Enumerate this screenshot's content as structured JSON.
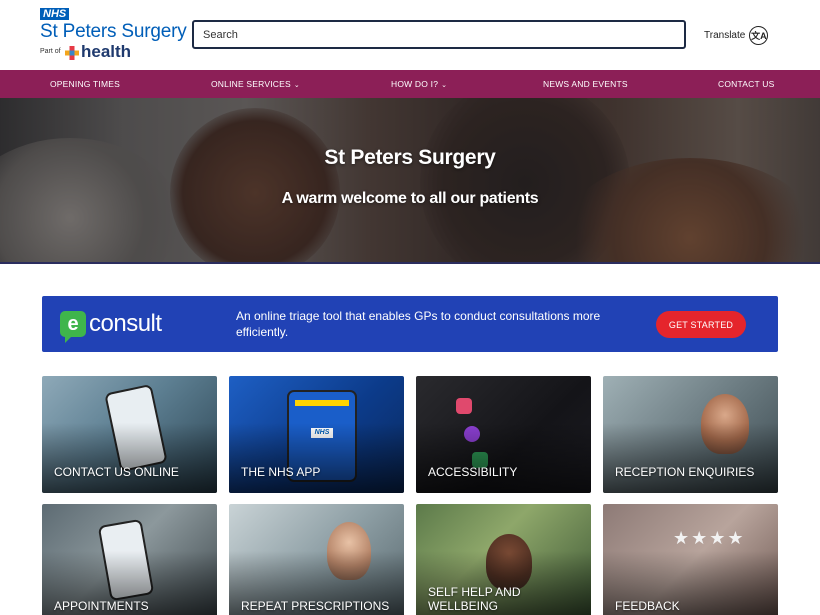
{
  "header": {
    "nhs_badge": "NHS",
    "practice_name": "St Peters Surgery",
    "part_of": "Part of",
    "health_word": "health",
    "search_placeholder": "Search",
    "translate_label": "Translate",
    "translate_icon": "translate-icon"
  },
  "nav": {
    "items": [
      {
        "label": "OPENING TIMES",
        "has_dropdown": false
      },
      {
        "label": "ONLINE SERVICES",
        "has_dropdown": true
      },
      {
        "label": "HOW DO I?",
        "has_dropdown": true
      },
      {
        "label": "NEWS AND EVENTS",
        "has_dropdown": false
      },
      {
        "label": "CONTACT US",
        "has_dropdown": false
      }
    ],
    "dropdown_glyph": "⌄"
  },
  "hero": {
    "title": "St Peters Surgery",
    "subtitle": "A warm welcome to all our patients"
  },
  "econsult": {
    "logo_letter": "e",
    "logo_word": "consult",
    "description": "An online triage tool that enables GPs to conduct consultations more efficiently.",
    "button_label": "GET STARTED"
  },
  "cards": [
    {
      "label": "CONTACT US ONLINE"
    },
    {
      "label": "THE NHS APP"
    },
    {
      "label": "ACCESSIBILITY"
    },
    {
      "label": "RECEPTION ENQUIRIES"
    },
    {
      "label": "APPOINTMENTS"
    },
    {
      "label": "REPEAT PRESCRIPTIONS"
    },
    {
      "label": "SELF HELP AND WELLBEING"
    },
    {
      "label": "FEEDBACK"
    }
  ],
  "colors": {
    "nhs_blue": "#005eb8",
    "nav_bg": "#8c1f57",
    "econsult_bg": "#2142b5",
    "econsult_button": "#e5252c",
    "econsult_green": "#3fb54b"
  }
}
